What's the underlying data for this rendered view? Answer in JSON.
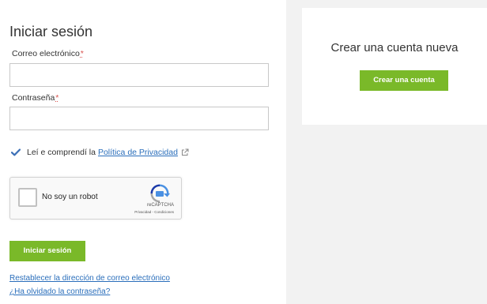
{
  "login": {
    "title": "Iniciar sesión",
    "email_label": "Correo electrónico",
    "password_label": "Contraseña",
    "required_mark": "*",
    "email_value": "",
    "password_value": "",
    "privacy_checked": true,
    "privacy_text": "Leí e comprendí la",
    "privacy_link": "Política de Privacidad",
    "submit_label": "Iniciar sesión",
    "reset_email_link": "Restablecer la dirección de correo electrónico",
    "forgot_password_link": "¿Ha olvidado la contraseña?"
  },
  "recaptcha": {
    "label": "No soy un robot",
    "brand": "reCAPTCHA",
    "links": "Privacidad - Condiciones"
  },
  "signup": {
    "title": "Crear una cuenta nueva",
    "button_label": "Crear una cuenta"
  },
  "colors": {
    "accent_green": "#7ab929",
    "link_blue": "#2a6ebb",
    "panel_gray": "#f2f2f2",
    "checkbox_blue": "#3b6fb6"
  },
  "icons": {
    "checkbox": "check-icon",
    "external_link": "external-link-icon",
    "recaptcha_logo": "recaptcha-logo-icon"
  }
}
